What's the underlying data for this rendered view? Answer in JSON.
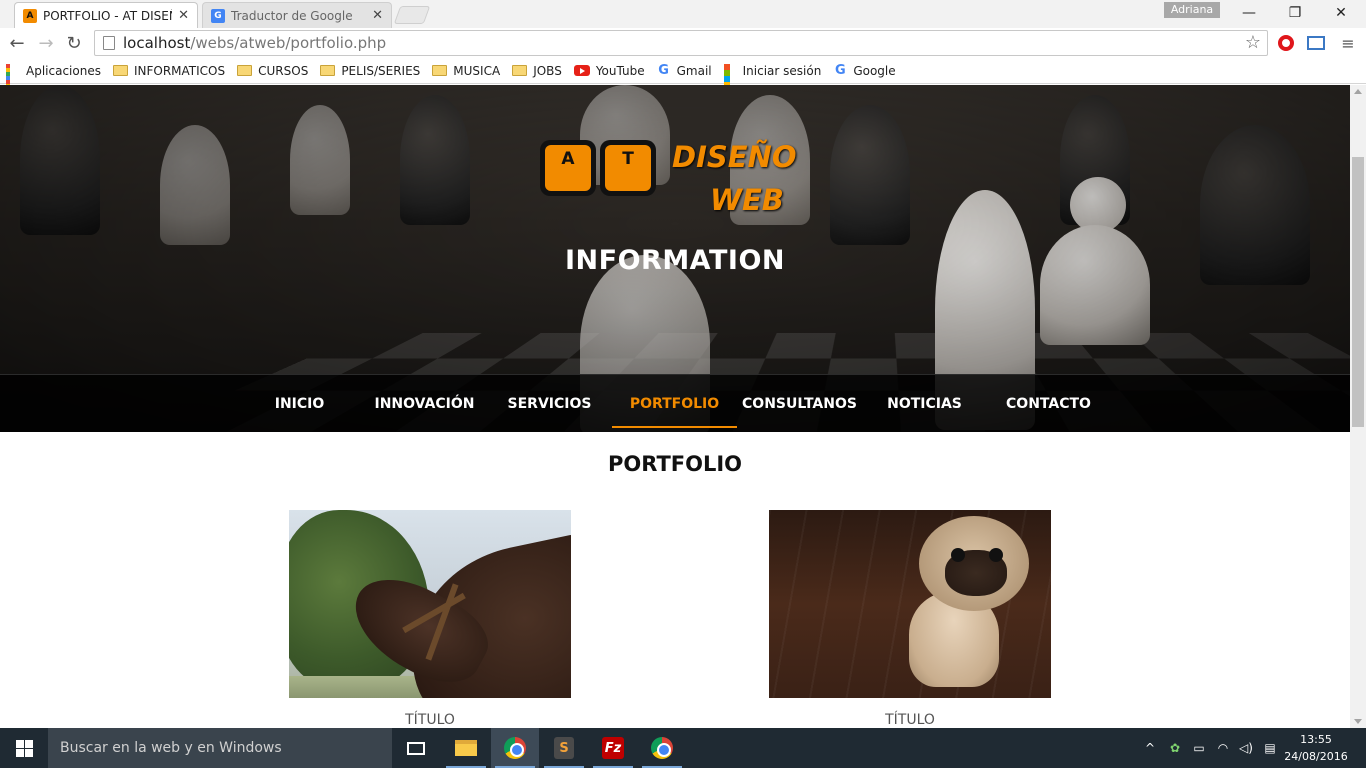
{
  "browser": {
    "tabs": [
      {
        "title": "PORTFOLIO - AT DISEÑO W",
        "active": true
      },
      {
        "title": "Traductor de Google",
        "active": false
      }
    ],
    "user": "Adriana",
    "url_host": "localhost",
    "url_path": "/webs/atweb/portfolio.php",
    "bookmarks": [
      {
        "label": "Aplicaciones",
        "icon": "apps-icon"
      },
      {
        "label": "INFORMATICOS",
        "icon": "folder-icon"
      },
      {
        "label": "CURSOS",
        "icon": "folder-icon"
      },
      {
        "label": "PELIS/SERIES",
        "icon": "folder-icon"
      },
      {
        "label": "MUSICA",
        "icon": "folder-icon"
      },
      {
        "label": "JOBS",
        "icon": "folder-icon"
      },
      {
        "label": "YouTube",
        "icon": "youtube-icon"
      },
      {
        "label": "Gmail",
        "icon": "google-icon"
      },
      {
        "label": "Iniciar sesión",
        "icon": "microsoft-icon"
      },
      {
        "label": "Google",
        "icon": "google-icon"
      }
    ]
  },
  "site": {
    "logo": {
      "key1": "A",
      "key2": "T",
      "line1": "DISEÑO",
      "line2": "WEB"
    },
    "hero_title": "INFORMATION",
    "nav": [
      {
        "label": "INICIO",
        "active": false
      },
      {
        "label": "INNOVACIÓN",
        "active": false
      },
      {
        "label": "SERVICIOS",
        "active": false
      },
      {
        "label": "PORTFOLIO",
        "active": true
      },
      {
        "label": "CONSULTANOS",
        "active": false
      },
      {
        "label": "NOTICIAS",
        "active": false
      },
      {
        "label": "CONTACTO",
        "active": false
      }
    ],
    "section_title": "PORTFOLIO",
    "cards": [
      {
        "caption": "TÍTULO",
        "image": "horse-photo"
      },
      {
        "caption": "TÍTULO",
        "image": "pug-photo"
      }
    ],
    "accent_color": "#f28b00"
  },
  "taskbar": {
    "search_placeholder": "Buscar en la web y en Windows",
    "time": "13:55",
    "date": "24/08/2016"
  }
}
